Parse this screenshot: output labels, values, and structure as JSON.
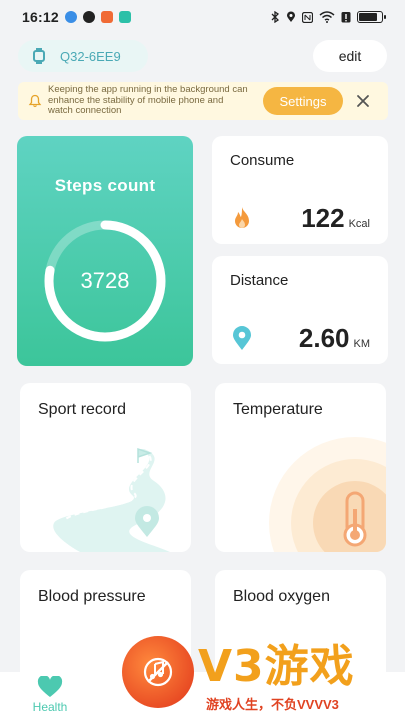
{
  "status_bar": {
    "time": "16:12",
    "battery_level": 0.8,
    "icons": [
      "bluetooth-icon",
      "location-icon",
      "nfc-icon",
      "wifi-icon",
      "battery-saver-icon",
      "battery-icon"
    ]
  },
  "header": {
    "device_name": "Q32-6EE9",
    "edit_label": "edit"
  },
  "banner": {
    "message": "Keeping the app running in the background can enhance the stability of mobile phone and watch connection",
    "settings_label": "Settings"
  },
  "steps": {
    "title": "Steps count",
    "value": "3728",
    "progress": 0.78
  },
  "consume": {
    "title": "Consume",
    "value": "122",
    "unit": "Kcal"
  },
  "distance": {
    "title": "Distance",
    "value": "2.60",
    "unit": "KM"
  },
  "cards": {
    "sport_record": "Sport record",
    "temperature": "Temperature",
    "blood_pressure": "Blood pressure",
    "blood_oxygen": "Blood oxygen"
  },
  "tabs": {
    "health": "Health"
  },
  "watermark": {
    "logo": "V3游戏",
    "slogan": "游戏人生，不负VVVV3"
  },
  "colors": {
    "accent": "#4cc9b0",
    "steps_gradient_top": "#5fd3c2",
    "steps_gradient_bottom": "#3cc59a",
    "banner_bg": "#fff8e0",
    "settings_button": "#f5b642",
    "flame": "#f49a3c",
    "location": "#57c6d6"
  }
}
